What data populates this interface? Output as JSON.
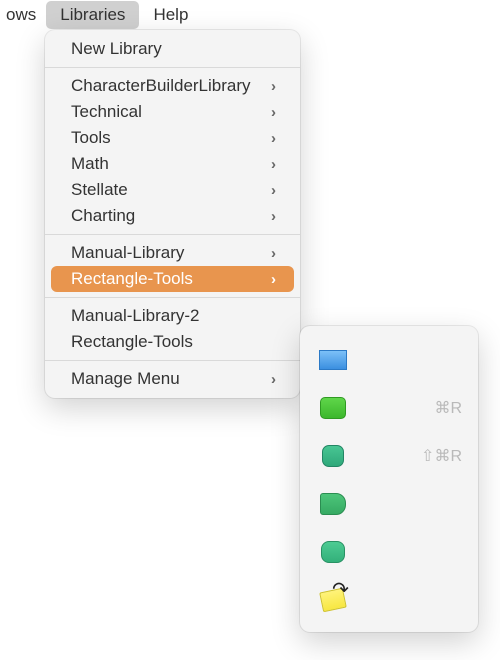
{
  "menubar": {
    "item0": "ows",
    "item1": "Libraries",
    "item2": "Help"
  },
  "menu": {
    "newLibrary": "New Library",
    "characterBuilder": "CharacterBuilderLibrary",
    "technical": "Technical",
    "tools": "Tools",
    "math": "Math",
    "stellate": "Stellate",
    "charting": "Charting",
    "manualLibrary": "Manual-Library",
    "rectangleTools": "Rectangle-Tools",
    "manualLibrary2": "Manual-Library-2",
    "rectangleTools2": "Rectangle-Tools",
    "manageMenu": "Manage Menu"
  },
  "submenu": {
    "shortcut1": "⌘R",
    "shortcut2": "⇧⌘R"
  }
}
